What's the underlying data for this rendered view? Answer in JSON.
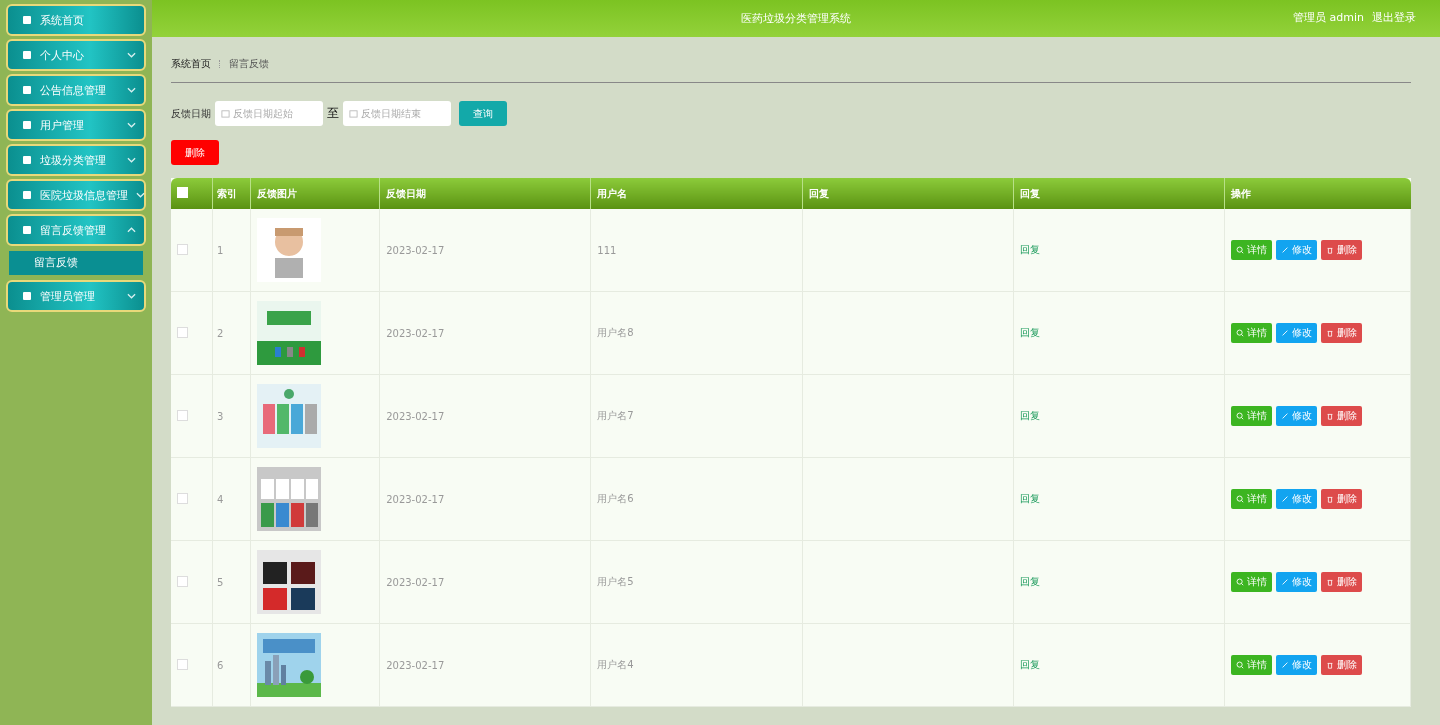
{
  "sidebar": {
    "items": [
      {
        "label": "系统首页"
      },
      {
        "label": "个人中心",
        "expanded": false
      },
      {
        "label": "公告信息管理",
        "expanded": false
      },
      {
        "label": "用户管理",
        "expanded": false
      },
      {
        "label": "垃圾分类管理",
        "expanded": false
      },
      {
        "label": "医院垃圾信息管理",
        "expanded": false
      },
      {
        "label": "留言反馈管理",
        "expanded": true,
        "children": [
          {
            "label": "留言反馈",
            "selected": true
          }
        ]
      },
      {
        "label": "管理员管理",
        "expanded": false
      }
    ]
  },
  "header": {
    "title": "医药垃圾分类管理系统",
    "user": "管理员 admin",
    "logout": "退出登录"
  },
  "breadcrumb": [
    "系统首页",
    "留言反馈"
  ],
  "filter": {
    "label": "反馈日期",
    "start_placeholder": "反馈日期起始",
    "separator": "至",
    "end_placeholder": "反馈日期结束",
    "search_button": "查询"
  },
  "delete_button": "删除",
  "table": {
    "header_checked": false,
    "columns": [
      "索引",
      "反馈图片",
      "反馈日期",
      "用户名",
      "回复",
      "回复",
      "操作"
    ],
    "rows": [
      {
        "checked": false,
        "index": "1",
        "date": "2023-02-17",
        "user": "111",
        "reply_link": "回复",
        "actions": [
          "详情",
          "修改",
          "删除"
        ]
      },
      {
        "checked": false,
        "index": "2",
        "date": "2023-02-17",
        "user": "用户名8",
        "reply_link": "回复",
        "actions": [
          "详情",
          "修改",
          "删除"
        ]
      },
      {
        "checked": false,
        "index": "3",
        "date": "2023-02-17",
        "user": "用户名7",
        "reply_link": "回复",
        "actions": [
          "详情",
          "修改",
          "删除"
        ]
      },
      {
        "checked": false,
        "index": "4",
        "date": "2023-02-17",
        "user": "用户名6",
        "reply_link": "回复",
        "actions": [
          "详情",
          "修改",
          "删除"
        ]
      },
      {
        "checked": false,
        "index": "5",
        "date": "2023-02-17",
        "user": "用户名5",
        "reply_link": "回复",
        "actions": [
          "详情",
          "修改",
          "删除"
        ]
      },
      {
        "checked": false,
        "index": "6",
        "date": "2023-02-17",
        "user": "用户名4",
        "reply_link": "回复",
        "actions": [
          "详情",
          "修改",
          "删除"
        ]
      }
    ]
  }
}
